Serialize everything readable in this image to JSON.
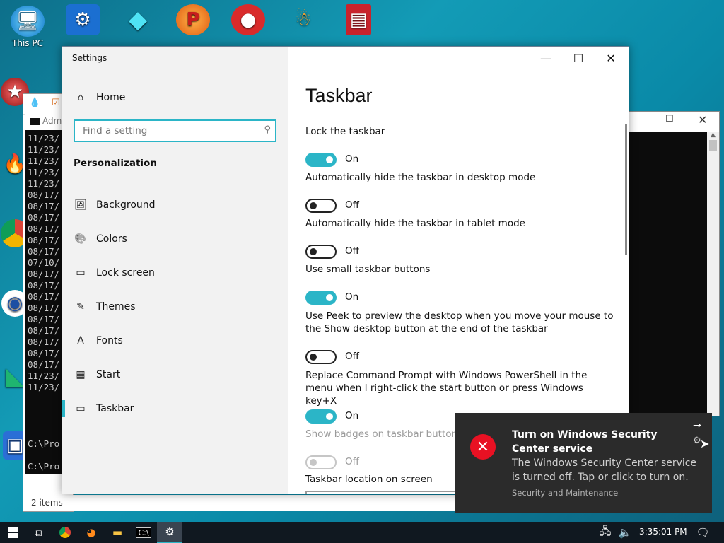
{
  "desktop": {
    "icons": [
      {
        "label": "This PC"
      },
      {
        "label": ""
      },
      {
        "label": ""
      },
      {
        "label": ""
      },
      {
        "label": ""
      },
      {
        "label": ""
      },
      {
        "label": ""
      }
    ]
  },
  "background_windows": {
    "cmd_tab_label": "Adm",
    "cmd_lines": [
      "11/23/",
      "11/23/",
      "11/23/",
      "11/23/",
      "11/23/",
      "08/17/",
      "08/17/",
      "08/17/",
      "08/17/",
      "08/17/",
      "08/17/",
      "07/10/",
      "08/17/",
      "08/17/",
      "08/17/",
      "08/17/",
      "08/17/",
      "08/17/",
      "08/17/",
      "08/17/",
      "08/17/",
      "11/23/",
      "11/23/"
    ],
    "prompt1": "C:\\Pro",
    "prompt2": "C:\\Pro",
    "status_items": "2 items"
  },
  "settings": {
    "window_title": "Settings",
    "home_label": "Home",
    "search_placeholder": "Find a setting",
    "section_title": "Personalization",
    "nav": [
      {
        "label": "Background",
        "icon": "picture-icon"
      },
      {
        "label": "Colors",
        "icon": "palette-icon"
      },
      {
        "label": "Lock screen",
        "icon": "lock-screen-icon"
      },
      {
        "label": "Themes",
        "icon": "themes-icon"
      },
      {
        "label": "Fonts",
        "icon": "fonts-icon"
      },
      {
        "label": "Start",
        "icon": "start-icon"
      },
      {
        "label": "Taskbar",
        "icon": "taskbar-icon",
        "selected": true
      }
    ],
    "page_title": "Taskbar",
    "options": [
      {
        "label": "Lock the taskbar",
        "state": "On"
      },
      {
        "label": "Automatically hide the taskbar in desktop mode",
        "state": "Off"
      },
      {
        "label": "Automatically hide the taskbar in tablet mode",
        "state": "Off"
      },
      {
        "label": "Use small taskbar buttons",
        "state": "On"
      },
      {
        "label": "Use Peek to preview the desktop when you move your mouse to the Show desktop button at the end of the taskbar",
        "state": "Off"
      },
      {
        "label": "Replace Command Prompt with Windows PowerShell in the menu when I right-click the start button or press Windows key+X",
        "state": "On"
      },
      {
        "label": "Show badges on taskbar buttons",
        "state": "Off",
        "disabled": true
      }
    ],
    "location_label": "Taskbar location on screen"
  },
  "toast": {
    "title": "Turn on Windows Security Center service",
    "body": "The Windows Security Center service is turned off. Tap or click to turn on.",
    "source": "Security and Maintenance"
  },
  "taskbar": {
    "clock": "3:35:01 PM"
  },
  "colors": {
    "accent": "#2bb5c7",
    "toast_bg": "#2b2b2b",
    "error_red": "#e81123"
  }
}
